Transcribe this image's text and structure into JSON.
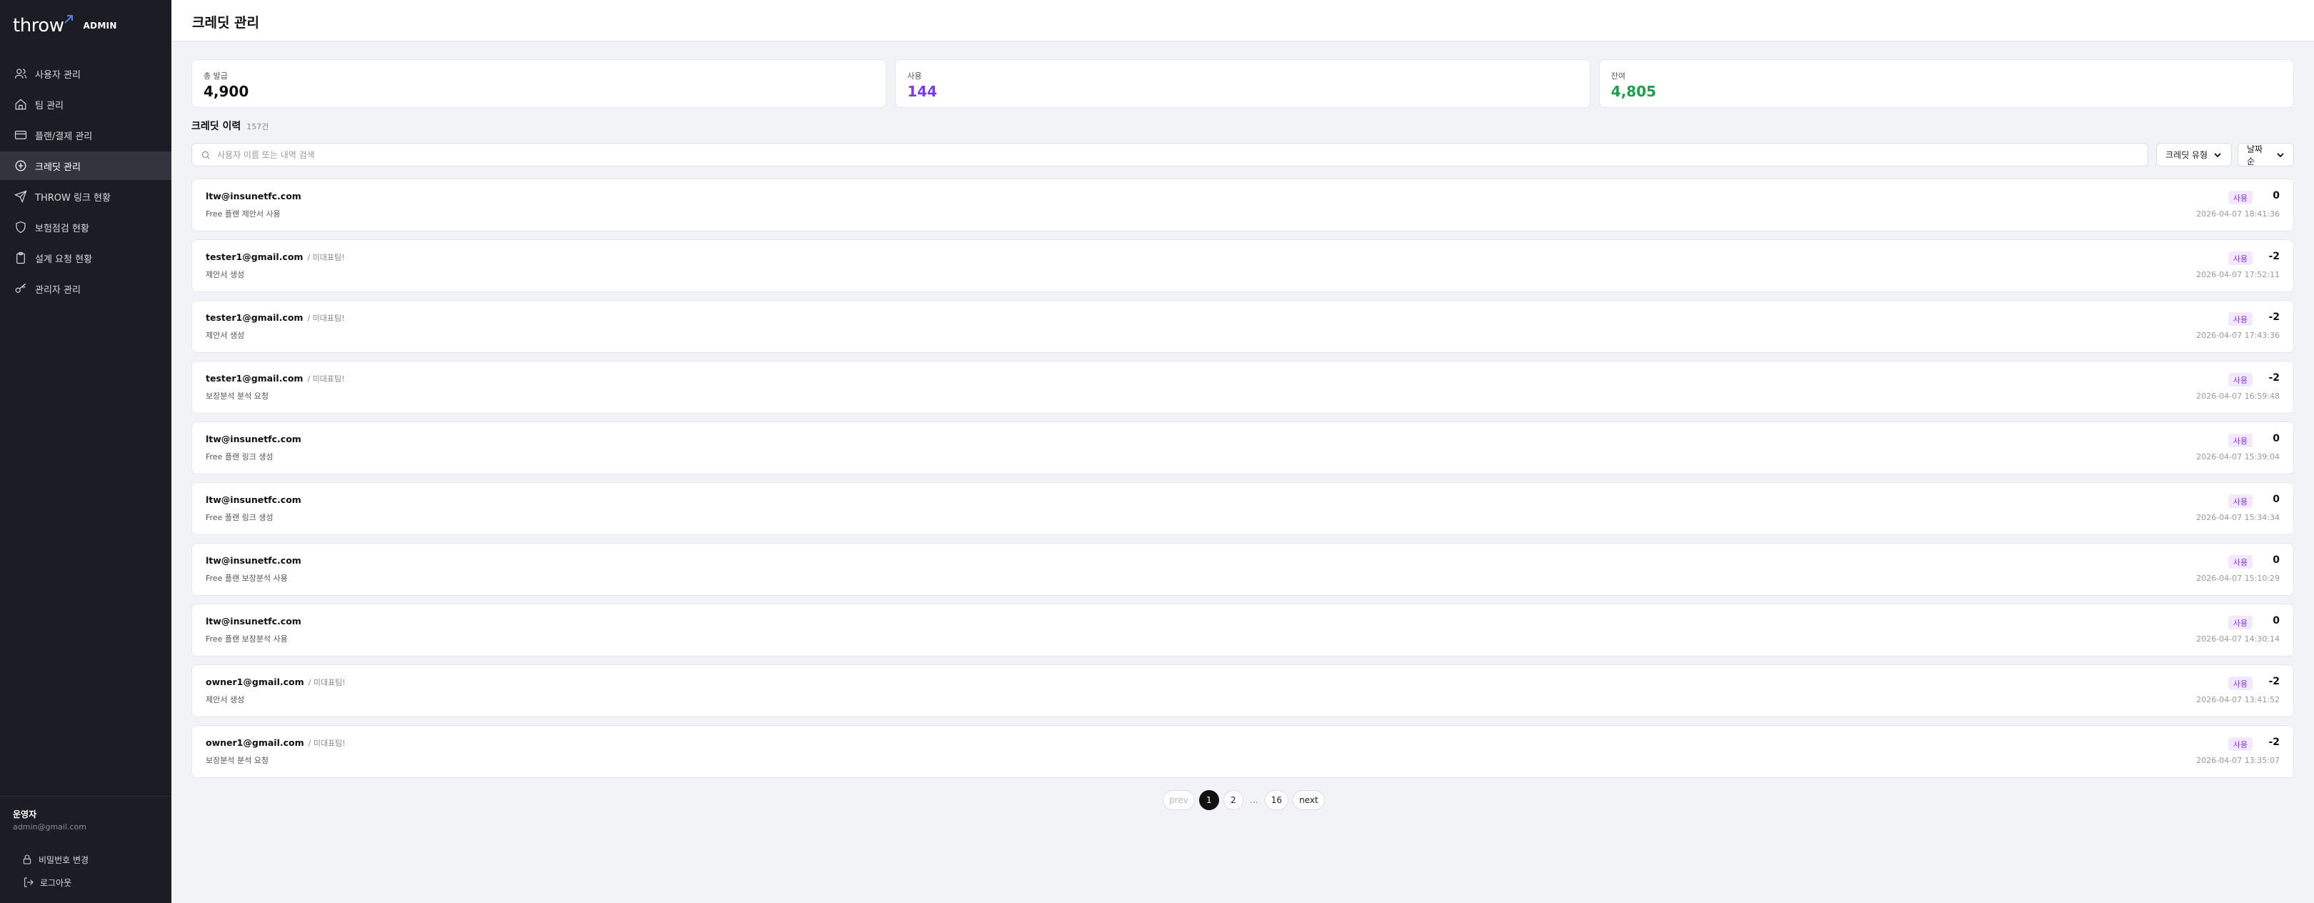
{
  "sidebar": {
    "logo": "throw",
    "badge": "ADMIN",
    "items": [
      {
        "label": "사용자 관리",
        "icon": "users-icon"
      },
      {
        "label": "팀 관리",
        "icon": "home-icon"
      },
      {
        "label": "플랜/결제 관리",
        "icon": "credit-card-icon"
      },
      {
        "label": "크레딧 관리",
        "icon": "credit-coin-icon"
      },
      {
        "label": "THROW 링크 현황",
        "icon": "send-icon"
      },
      {
        "label": "보험점검 현황",
        "icon": "shield-icon"
      },
      {
        "label": "설계 요청 현황",
        "icon": "clipboard-icon"
      },
      {
        "label": "관리자 관리",
        "icon": "key-icon"
      }
    ],
    "active_index": 3,
    "user": {
      "role": "운영자",
      "email": "admin@gmail.com",
      "change_password": "비밀번호 변경",
      "logout": "로그아웃"
    }
  },
  "header": {
    "title": "크레딧 관리"
  },
  "stats": [
    {
      "label": "총 발급",
      "value": "4,900",
      "color": "#111111"
    },
    {
      "label": "사용",
      "value": "144",
      "color": "#7c3aed"
    },
    {
      "label": "잔여",
      "value": "4,805",
      "color": "#16a34a"
    }
  ],
  "history": {
    "title": "크레딧 이력",
    "count": "157건",
    "search_placeholder": "사용자 이름 또는 내역 검색",
    "type_filter": "크레딧 유형",
    "sort": "날짜순"
  },
  "rows": [
    {
      "email": "ltw@insunetfc.com",
      "team": "",
      "desc": "Free 플랜 제안서 사용",
      "badge": "사용",
      "amount": "0",
      "time": "2026-04-07 18:41:36"
    },
    {
      "email": "tester1@gmail.com",
      "team": "/ 미대표팀!",
      "desc": "제안서 생성",
      "badge": "사용",
      "amount": "-2",
      "time": "2026-04-07 17:52:11"
    },
    {
      "email": "tester1@gmail.com",
      "team": "/ 미대표팀!",
      "desc": "제안서 생성",
      "badge": "사용",
      "amount": "-2",
      "time": "2026-04-07 17:43:36"
    },
    {
      "email": "tester1@gmail.com",
      "team": "/ 미대표팀!",
      "desc": "보장분석 분석 요청",
      "badge": "사용",
      "amount": "-2",
      "time": "2026-04-07 16:59:48"
    },
    {
      "email": "ltw@insunetfc.com",
      "team": "",
      "desc": "Free 플랜 링크 생성",
      "badge": "사용",
      "amount": "0",
      "time": "2026-04-07 15:39:04"
    },
    {
      "email": "ltw@insunetfc.com",
      "team": "",
      "desc": "Free 플랜 링크 생성",
      "badge": "사용",
      "amount": "0",
      "time": "2026-04-07 15:34:34"
    },
    {
      "email": "ltw@insunetfc.com",
      "team": "",
      "desc": "Free 플랜 보장분석 사용",
      "badge": "사용",
      "amount": "0",
      "time": "2026-04-07 15:10:29"
    },
    {
      "email": "ltw@insunetfc.com",
      "team": "",
      "desc": "Free 플랜 보장분석 사용",
      "badge": "사용",
      "amount": "0",
      "time": "2026-04-07 14:30:14"
    },
    {
      "email": "owner1@gmail.com",
      "team": "/ 미대표팀!",
      "desc": "제안서 생성",
      "badge": "사용",
      "amount": "-2",
      "time": "2026-04-07 13:41:52"
    },
    {
      "email": "owner1@gmail.com",
      "team": "/ 미대표팀!",
      "desc": "보장분석 분석 요청",
      "badge": "사용",
      "amount": "-2",
      "time": "2026-04-07 13:35:07"
    }
  ],
  "pagination": {
    "prev": "prev",
    "pages": [
      "1",
      "2",
      "...",
      "16"
    ],
    "current": "1",
    "next": "next"
  }
}
